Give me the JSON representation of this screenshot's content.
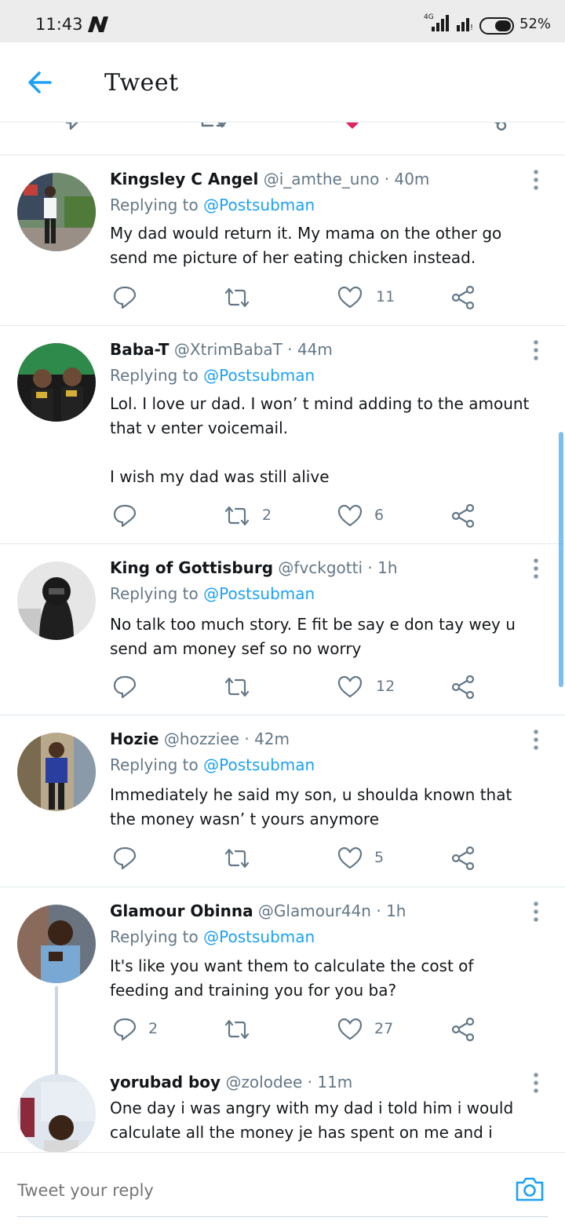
{
  "status_bar": {
    "time": "11:43",
    "network": "4G",
    "battery": "52%"
  },
  "header": {
    "title": "Tweet",
    "back_icon": "arrow-left-icon"
  },
  "colors": {
    "accent": "#1da1f2",
    "like": "#e0245e",
    "muted": "#657786",
    "text": "#14171a"
  },
  "tweets": [
    {
      "name": "Kingsley C Angel",
      "handle": "@i_amthe_uno",
      "time": "40m",
      "replying_label": "Replying to",
      "replying_to": "@Postsubman",
      "text": "My dad would return it. My mama on the other go\nsend me picture of her eating chicken instead.",
      "replies": "",
      "retweets": "",
      "likes": "11"
    },
    {
      "name": "Baba-T",
      "handle": "@XtrimBabaT",
      "time": "44m",
      "replying_label": "Replying to",
      "replying_to": "@Postsubman",
      "text": "Lol. I love ur dad. I won’ t mind adding to the amount\nthat v enter voicemail.\n\nI wish my dad was still alive",
      "replies": "",
      "retweets": "2",
      "likes": "6"
    },
    {
      "name": "King of Gottisburg",
      "handle": "@fvckgotti",
      "time": "1h",
      "replying_label": "Replying to",
      "replying_to": "@Postsubman",
      "text": "No talk too much story. E fit be say e don tay wey u\nsend am money sef so no worry",
      "replies": "",
      "retweets": "",
      "likes": "12"
    },
    {
      "name": "Hozie",
      "handle": "@hozziee",
      "time": "42m",
      "replying_label": "Replying to",
      "replying_to": "@Postsubman",
      "text": "Immediately he said my son, u shoulda known that\nthe money wasn’ t yours anymore",
      "replies": "",
      "retweets": "",
      "likes": "5"
    },
    {
      "name": "Glamour Obinna",
      "handle": "@Glamour44n",
      "time": "1h",
      "replying_label": "Replying to",
      "replying_to": "@Postsubman",
      "text": "It's like you want them to calculate the cost of\nfeeding and training you for you ba?",
      "replies": "2",
      "retweets": "",
      "likes": "27"
    },
    {
      "name": "yorubad boy",
      "handle": "@zolodee",
      "time": "11m",
      "text": "One day i was angry with my dad i told him i would\ncalculate all the money je has spent on me and i"
    }
  ],
  "reply_bar": {
    "placeholder": "Tweet your reply",
    "camera_icon": "camera-icon"
  }
}
